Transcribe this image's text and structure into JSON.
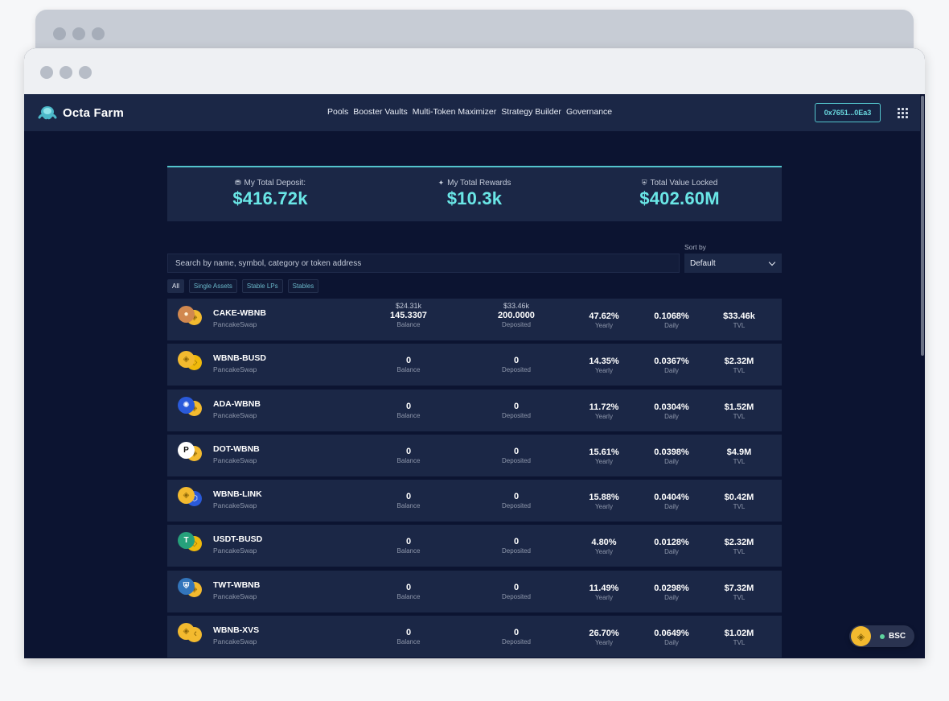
{
  "app": {
    "name": "Octa Farm"
  },
  "nav": {
    "links": [
      "Pools",
      "Booster Vaults",
      "Multi-Token Maximizer",
      "Strategy Builder",
      "Governance"
    ]
  },
  "wallet": {
    "address": "0x7651...0Ea3"
  },
  "stats": [
    {
      "label": "My Total Deposit:",
      "value": "$416.72k",
      "icon": "deposit-icon"
    },
    {
      "label": "My Total Rewards",
      "value": "$10.3k",
      "icon": "rewards-icon"
    },
    {
      "label": "Total Value Locked",
      "value": "$402.60M",
      "icon": "shield-icon"
    }
  ],
  "search": {
    "placeholder": "Search by name, symbol, category or token address"
  },
  "sort": {
    "label": "Sort by",
    "value": "Default"
  },
  "filters": [
    "All",
    "Single Assets",
    "Stable LPs",
    "Stables"
  ],
  "column_labels": {
    "balance": "Balance",
    "deposited": "Deposited",
    "yearly": "Yearly",
    "daily": "Daily",
    "tvl": "TVL"
  },
  "pools": [
    {
      "pair": "CAKE-WBNB",
      "dex": "PancakeSwap",
      "balance_usd": "$24.31k",
      "balance": "145.3307",
      "deposited_usd": "$33.46k",
      "deposited": "200.0000",
      "yearly": "47.62%",
      "daily": "0.1068%",
      "tvl": "$33.46k",
      "tokens": [
        "cake-icon",
        "bnb-icon"
      ]
    },
    {
      "pair": "WBNB-BUSD",
      "dex": "PancakeSwap",
      "balance_usd": "",
      "balance": "0",
      "deposited_usd": "",
      "deposited": "0",
      "yearly": "14.35%",
      "daily": "0.0367%",
      "tvl": "$2.32M",
      "tokens": [
        "bnb-icon",
        "busd-icon"
      ]
    },
    {
      "pair": "ADA-WBNB",
      "dex": "PancakeSwap",
      "balance_usd": "",
      "balance": "0",
      "deposited_usd": "",
      "deposited": "0",
      "yearly": "11.72%",
      "daily": "0.0304%",
      "tvl": "$1.52M",
      "tokens": [
        "ada-icon",
        "bnb-icon"
      ]
    },
    {
      "pair": "DOT-WBNB",
      "dex": "PancakeSwap",
      "balance_usd": "",
      "balance": "0",
      "deposited_usd": "",
      "deposited": "0",
      "yearly": "15.61%",
      "daily": "0.0398%",
      "tvl": "$4.9M",
      "tokens": [
        "dot-icon",
        "bnb-icon"
      ]
    },
    {
      "pair": "WBNB-LINK",
      "dex": "PancakeSwap",
      "balance_usd": "",
      "balance": "0",
      "deposited_usd": "",
      "deposited": "0",
      "yearly": "15.88%",
      "daily": "0.0404%",
      "tvl": "$0.42M",
      "tokens": [
        "bnb-icon",
        "link-icon"
      ]
    },
    {
      "pair": "USDT-BUSD",
      "dex": "PancakeSwap",
      "balance_usd": "",
      "balance": "0",
      "deposited_usd": "",
      "deposited": "0",
      "yearly": "4.80%",
      "daily": "0.0128%",
      "tvl": "$2.32M",
      "tokens": [
        "usdt-icon",
        "busd-icon"
      ]
    },
    {
      "pair": "TWT-WBNB",
      "dex": "PancakeSwap",
      "balance_usd": "",
      "balance": "0",
      "deposited_usd": "",
      "deposited": "0",
      "yearly": "11.49%",
      "daily": "0.0298%",
      "tvl": "$7.32M",
      "tokens": [
        "twt-icon",
        "bnb-icon"
      ]
    },
    {
      "pair": "WBNB-XVS",
      "dex": "PancakeSwap",
      "balance_usd": "",
      "balance": "0",
      "deposited_usd": "",
      "deposited": "0",
      "yearly": "26.70%",
      "daily": "0.0649%",
      "tvl": "$1.02M",
      "tokens": [
        "bnb-icon",
        "xvs-icon"
      ]
    }
  ],
  "network": {
    "name": "BSC",
    "status_color": "#5dd39e"
  },
  "colors": {
    "accent": "#6ae6e6",
    "panel": "#1b2746",
    "background": "#0c1431",
    "bnb": "#f3ba2f"
  }
}
